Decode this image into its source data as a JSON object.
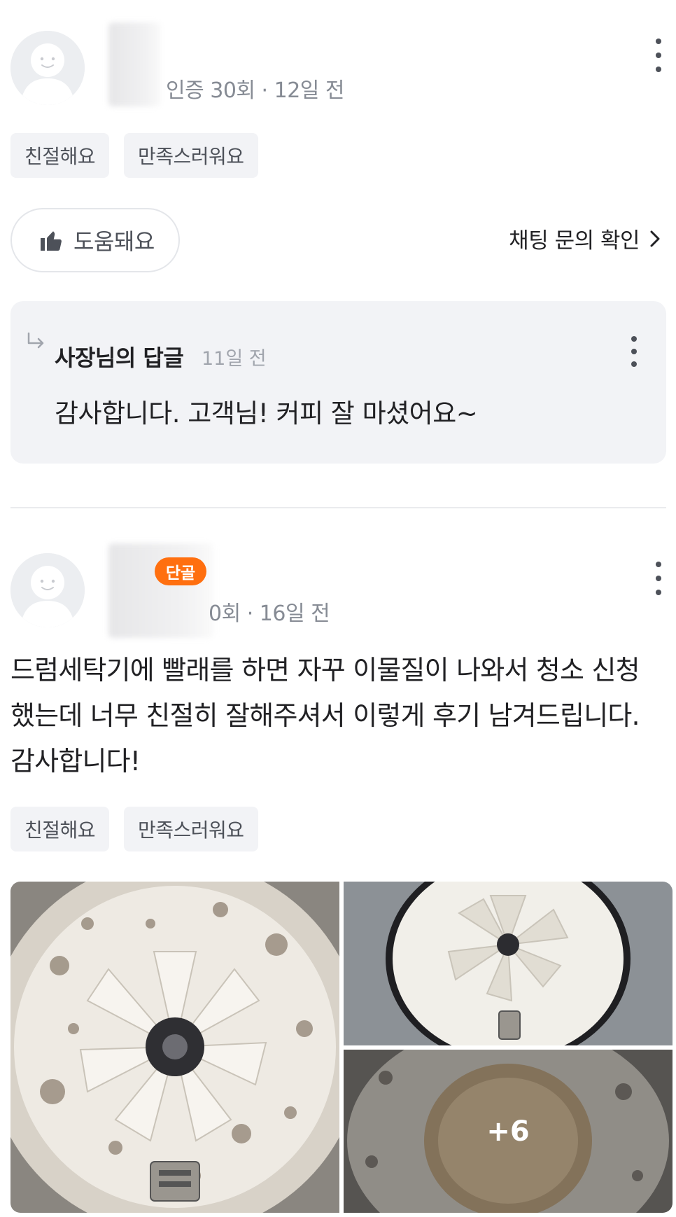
{
  "review1": {
    "meta": "인증 30회 · 12일 전",
    "tags": [
      "친절해요",
      "만족스러워요"
    ],
    "helpful_label": "도움돼요",
    "chat_link_label": "채팅 문의 확인",
    "reply": {
      "title": "사장님의 답글",
      "time": "11일 전",
      "body": "감사합니다. 고객님! 커피 잘 마셨어요~"
    }
  },
  "review2": {
    "badge": "단골",
    "meta": "0회 · 16일 전",
    "text": "드럼세탁기에 빨래를 하면 자꾸 이물질이 나와서 청소 신청 했는데 너무 친절히 잘해주셔서 이렇게 후기 남겨드립니다. 감사합니다!",
    "tags": [
      "친절해요",
      "만족스러워요"
    ],
    "more_photos": "+6"
  },
  "colors": {
    "accent": "#ff6f0f",
    "tag_bg": "#f2f3f6",
    "text_secondary": "#868b94"
  },
  "icons": [
    "avatar-icon",
    "more-vert-icon",
    "thumbs-up-icon",
    "chevron-right-icon",
    "reply-arrow-icon"
  ]
}
